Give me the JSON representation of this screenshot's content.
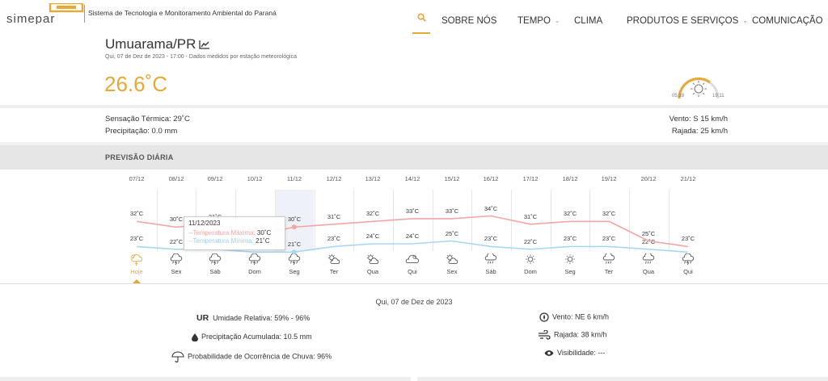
{
  "header": {
    "logo_text": "simepar",
    "tagline": "Sistema de Tecnologia e Monitoramento Ambiental do Paraná",
    "nav": [
      {
        "label": "SOBRE NÓS",
        "has_dropdown": false
      },
      {
        "label": "TEMPO",
        "has_dropdown": true
      },
      {
        "label": "CLIMA",
        "has_dropdown": false
      },
      {
        "label": "PRODUTOS E SERVIÇOS",
        "has_dropdown": true
      },
      {
        "label": "COMUNICAÇÃO",
        "has_dropdown": true
      }
    ],
    "search_icon": "search-icon"
  },
  "station": {
    "city": "Umuarama/PR",
    "observation_time": "Qui, 07 de Dez de 2023 - 17:00 - Dados medidos por estação meteorológica",
    "temperature": "26.6˚C",
    "sunrise": "05:39",
    "sunset": "19:11"
  },
  "current": {
    "feels_like": "Sensação Térmica: 29˚C",
    "precipitation": "Precipitação: 0.0 mm",
    "wind": "Vento: S 15 km/h",
    "gust": "Rajada: 25 km/h"
  },
  "daily": {
    "title": "PREVISÃO DIÁRIA",
    "selected_index": 0,
    "highlighted_index": 4,
    "days": [
      {
        "date": "07/12",
        "dow": "Hoje",
        "max": "32˚C",
        "min": "23˚C",
        "icon": "thunderstorm-sun-icon"
      },
      {
        "date": "08/12",
        "dow": "Sex",
        "max": "30˚C",
        "min": "22˚C",
        "icon": "thunderstorm-icon"
      },
      {
        "date": "09/12",
        "dow": "Sáb",
        "max": "31˚C",
        "min": "",
        "icon": "thunderstorm-icon"
      },
      {
        "date": "10/12",
        "dow": "Dom",
        "max": "27˚C",
        "min": "",
        "icon": "thunderstorm-icon"
      },
      {
        "date": "11/12",
        "dow": "Seg",
        "max": "30˚C",
        "min": "21˚C",
        "icon": "thunderstorm-icon"
      },
      {
        "date": "12/12",
        "dow": "Ter",
        "max": "31˚C",
        "min": "23˚C",
        "icon": "partly-cloudy-icon"
      },
      {
        "date": "13/12",
        "dow": "Qua",
        "max": "32˚C",
        "min": "24˚C",
        "icon": "partly-cloudy-icon"
      },
      {
        "date": "14/12",
        "dow": "Qui",
        "max": "33˚C",
        "min": "24˚C",
        "icon": "cloudy-icon"
      },
      {
        "date": "15/12",
        "dow": "Sex",
        "max": "33˚C",
        "min": "25˚C",
        "icon": "partly-cloudy-icon"
      },
      {
        "date": "16/12",
        "dow": "Sáb",
        "max": "34˚C",
        "min": "23˚C",
        "icon": "rain-icon"
      },
      {
        "date": "17/12",
        "dow": "Dom",
        "max": "31˚C",
        "min": "22˚C",
        "icon": "sun-icon"
      },
      {
        "date": "18/12",
        "dow": "Seg",
        "max": "32˚C",
        "min": "23˚C",
        "icon": "sun-icon"
      },
      {
        "date": "19/12",
        "dow": "Ter",
        "max": "32˚C",
        "min": "23˚C",
        "icon": "rain-icon"
      },
      {
        "date": "20/12",
        "dow": "Qua",
        "max": "25˚C",
        "min": "22˚C",
        "icon": "rain-icon"
      },
      {
        "date": "21/12",
        "dow": "Qui",
        "max": "23˚C",
        "min": "",
        "icon": "thunderstorm-icon"
      }
    ],
    "tooltip": {
      "date": "11/12/2023",
      "max_label": "--Temperatura Máxima:",
      "max_value": "30˚C",
      "min_label": "--Temperatura Mínima:",
      "min_value": "21˚C"
    }
  },
  "chart_data": {
    "type": "line",
    "categories": [
      "07/12",
      "08/12",
      "09/12",
      "10/12",
      "11/12",
      "12/12",
      "13/12",
      "14/12",
      "15/12",
      "16/12",
      "17/12",
      "18/12",
      "19/12",
      "20/12",
      "21/12"
    ],
    "series": [
      {
        "name": "Temperatura Máxima",
        "values": [
          32,
          30,
          31,
          27,
          30,
          31,
          32,
          33,
          33,
          34,
          31,
          32,
          32,
          25,
          23
        ],
        "color": "#f4a6a6"
      },
      {
        "name": "Temperatura Mínima",
        "values": [
          23,
          22,
          22,
          21,
          21,
          23,
          24,
          24,
          25,
          23,
          22,
          23,
          23,
          22,
          21
        ],
        "color": "#a9d6f5"
      }
    ]
  },
  "detail": {
    "date": "Qui, 07 de Dez de 2023",
    "ur_abbr": "UR",
    "humidity": "Umidade Relativa: 59% - 96%",
    "precip": "Precipitação Acumulada: 10.5 mm",
    "rain_prob": "Probabilidade de Ocorrência de Chuva: 96%",
    "wind": "Vento: NE 6 km/h",
    "gust": "Rajada: 38 km/h",
    "visibility": "Visibilidade: ---"
  },
  "colors": {
    "accent": "#e8a838",
    "max_line": "#f4a6a6",
    "min_line": "#a9d6f5"
  }
}
